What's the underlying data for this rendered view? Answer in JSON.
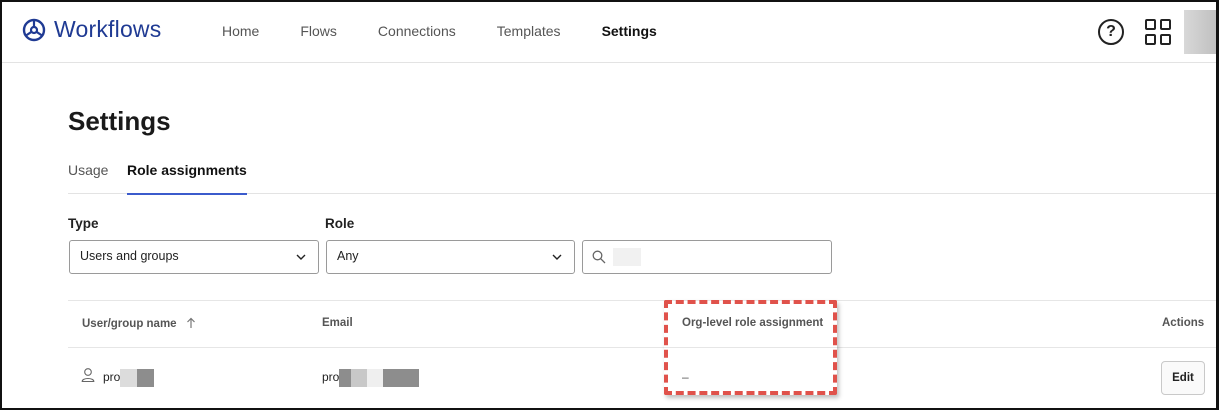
{
  "header": {
    "app_name": "Workflows",
    "nav": [
      "Home",
      "Flows",
      "Connections",
      "Templates",
      "Settings"
    ],
    "active_nav": "Settings"
  },
  "page": {
    "title": "Settings",
    "tabs": [
      "Usage",
      "Role assignments"
    ],
    "active_tab": "Role assignments"
  },
  "filters": {
    "type_label": "Type",
    "type_value": "Users and groups",
    "role_label": "Role",
    "role_value": "Any",
    "search_value": ""
  },
  "table": {
    "columns": {
      "name": "User/group name",
      "email": "Email",
      "org_role": "Org-level role assignment",
      "actions": "Actions"
    },
    "rows": [
      {
        "name": "pro",
        "email": "pro",
        "org_role": "–",
        "action": "Edit"
      }
    ]
  },
  "colors": {
    "brand": "#1f3a93",
    "active_tab_underline": "#3b5bcc",
    "highlight_border": "#e0524b"
  }
}
